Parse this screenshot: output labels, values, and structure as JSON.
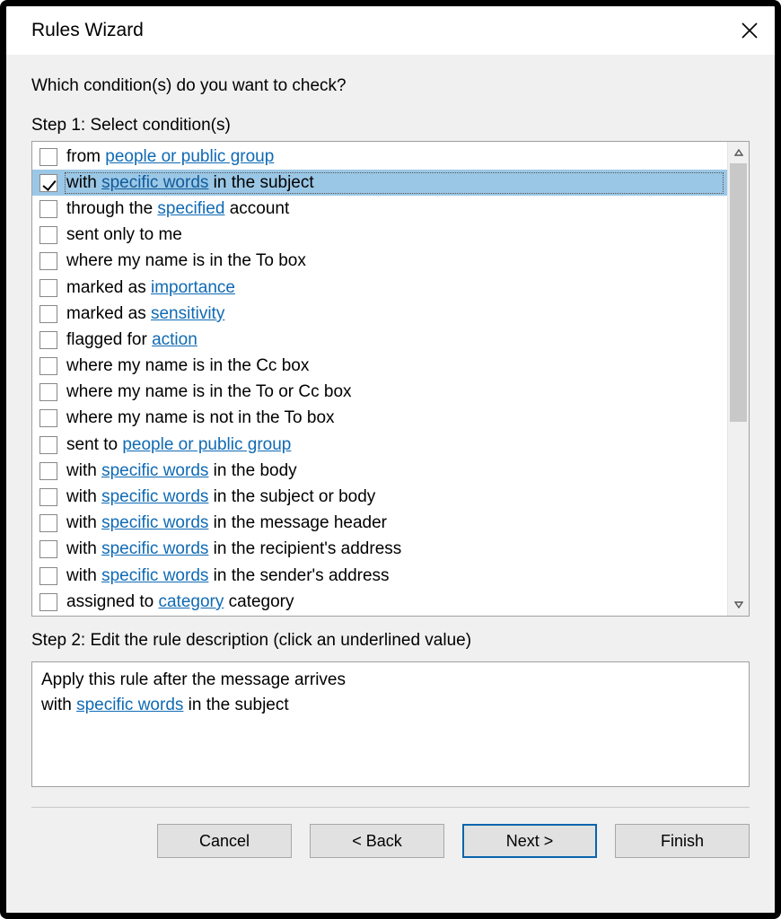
{
  "window": {
    "title": "Rules Wizard"
  },
  "prompt": "Which condition(s) do you want to check?",
  "step1_label": "Step 1: Select condition(s)",
  "step2_label": "Step 2: Edit the rule description (click an underlined value)",
  "conditions": [
    {
      "checked": false,
      "selected": false,
      "parts": [
        {
          "t": "from "
        },
        {
          "t": "people or public group",
          "link": true
        }
      ]
    },
    {
      "checked": true,
      "selected": true,
      "parts": [
        {
          "t": "with "
        },
        {
          "t": "specific words",
          "link": true
        },
        {
          "t": " in the subject"
        }
      ]
    },
    {
      "checked": false,
      "selected": false,
      "parts": [
        {
          "t": "through the "
        },
        {
          "t": "specified",
          "link": true
        },
        {
          "t": " account"
        }
      ]
    },
    {
      "checked": false,
      "selected": false,
      "parts": [
        {
          "t": "sent only to me"
        }
      ]
    },
    {
      "checked": false,
      "selected": false,
      "parts": [
        {
          "t": "where my name is in the To box"
        }
      ]
    },
    {
      "checked": false,
      "selected": false,
      "parts": [
        {
          "t": "marked as "
        },
        {
          "t": "importance",
          "link": true
        }
      ]
    },
    {
      "checked": false,
      "selected": false,
      "parts": [
        {
          "t": "marked as "
        },
        {
          "t": "sensitivity",
          "link": true
        }
      ]
    },
    {
      "checked": false,
      "selected": false,
      "parts": [
        {
          "t": "flagged for "
        },
        {
          "t": "action",
          "link": true
        }
      ]
    },
    {
      "checked": false,
      "selected": false,
      "parts": [
        {
          "t": "where my name is in the Cc box"
        }
      ]
    },
    {
      "checked": false,
      "selected": false,
      "parts": [
        {
          "t": "where my name is in the To or Cc box"
        }
      ]
    },
    {
      "checked": false,
      "selected": false,
      "parts": [
        {
          "t": "where my name is not in the To box"
        }
      ]
    },
    {
      "checked": false,
      "selected": false,
      "parts": [
        {
          "t": "sent to "
        },
        {
          "t": "people or public group",
          "link": true
        }
      ]
    },
    {
      "checked": false,
      "selected": false,
      "parts": [
        {
          "t": "with "
        },
        {
          "t": "specific words",
          "link": true
        },
        {
          "t": " in the body"
        }
      ]
    },
    {
      "checked": false,
      "selected": false,
      "parts": [
        {
          "t": "with "
        },
        {
          "t": "specific words",
          "link": true
        },
        {
          "t": " in the subject or body"
        }
      ]
    },
    {
      "checked": false,
      "selected": false,
      "parts": [
        {
          "t": "with "
        },
        {
          "t": "specific words",
          "link": true
        },
        {
          "t": " in the message header"
        }
      ]
    },
    {
      "checked": false,
      "selected": false,
      "parts": [
        {
          "t": "with "
        },
        {
          "t": "specific words",
          "link": true
        },
        {
          "t": " in the recipient's address"
        }
      ]
    },
    {
      "checked": false,
      "selected": false,
      "parts": [
        {
          "t": "with "
        },
        {
          "t": "specific words",
          "link": true
        },
        {
          "t": " in the sender's address"
        }
      ]
    },
    {
      "checked": false,
      "selected": false,
      "parts": [
        {
          "t": "assigned to "
        },
        {
          "t": "category",
          "link": true
        },
        {
          "t": " category"
        }
      ]
    }
  ],
  "description": {
    "line1": "Apply this rule after the message arrives",
    "line2_parts": [
      {
        "t": "with "
      },
      {
        "t": "specific words",
        "link": true
      },
      {
        "t": " in the subject"
      }
    ]
  },
  "buttons": {
    "cancel": "Cancel",
    "back": "< Back",
    "next": "Next >",
    "finish": "Finish"
  }
}
